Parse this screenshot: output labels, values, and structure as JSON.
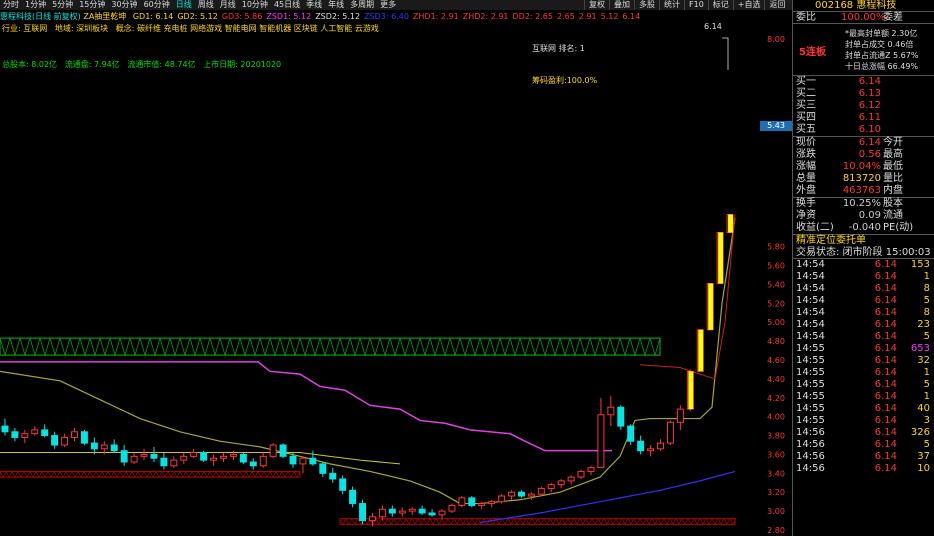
{
  "periods": [
    "分时",
    "1分钟",
    "5分钟",
    "15分钟",
    "30分钟",
    "60分钟",
    "日线",
    "周线",
    "月线",
    "10分钟",
    "45日线",
    "季线",
    "年线",
    "多周期",
    "更多"
  ],
  "active_period": "日线",
  "toolbar": [
    "复权",
    "叠加",
    "多股",
    "统计",
    "F10",
    "标记",
    "+自选",
    "返回"
  ],
  "chart": {
    "title": "惠程科技(日线 前复权)",
    "indicator_name": "ZA抽里乾坤",
    "indicator_values": [
      {
        "label": "GD1: 6.14",
        "color": "#ffd700"
      },
      {
        "label": "GD2: 5.12",
        "color": "#ffd700"
      },
      {
        "label": "GD3: 5.86",
        "color": "#ff3333"
      },
      {
        "label": "ZSD1: 5.12",
        "color": "#ff33ff"
      },
      {
        "label": "ZSD2: 5.12",
        "color": "#ddd"
      },
      {
        "label": "ZSD3: 6.40",
        "color": "#3333ff"
      },
      {
        "label": "ZHD1: 2.91",
        "color": "#ff3333"
      },
      {
        "label": "ZHD2: 2.91",
        "color": "#ff3333"
      },
      {
        "label": "DD2: 2.65",
        "color": "#ff3333"
      },
      {
        "label": "2.65",
        "color": "#ff3333"
      },
      {
        "label": "2.91",
        "color": "#ff3333"
      },
      {
        "label": "5.12",
        "color": "#ff3333"
      },
      {
        "label": "6.14",
        "color": "#ff3333"
      }
    ],
    "industry": "行业: 互联网",
    "region": "地域: 深圳板块",
    "concept": "概念: 碳纤维 充电桩 网络游戏 智能电网 智能机器 区块链 人工智能 云游戏",
    "total_cap": "总股本: 8.02亿",
    "float_cap": "流通盘: 7.94亿",
    "float_value": "流通市值: 48.74亿",
    "listing_date": "上市日期: 20201020",
    "sector_rank": "互联网    排名: 1",
    "chip_profit": "筹码盈利:100.0%",
    "high_label": "6.14",
    "current_price_tag": "5.43",
    "y_axis": {
      "min": 2.8,
      "max": 8.2,
      "ticks": [
        "8.00",
        "5.80",
        "5.60",
        "5.40",
        "5.20",
        "5.00",
        "4.80",
        "4.60",
        "4.40",
        "4.20",
        "4.00",
        "3.80",
        "3.60",
        "3.40",
        "3.20",
        "3.00",
        "2.80"
      ]
    }
  },
  "chart_data": {
    "type": "candlestick",
    "title": "惠程科技(日线 前复权)",
    "candles": [
      [
        3.9,
        3.98,
        3.8,
        3.84
      ],
      [
        3.84,
        3.88,
        3.74,
        3.78
      ],
      [
        3.78,
        3.86,
        3.72,
        3.82
      ],
      [
        3.82,
        3.9,
        3.8,
        3.86
      ],
      [
        3.86,
        3.92,
        3.78,
        3.8
      ],
      [
        3.8,
        3.84,
        3.66,
        3.7
      ],
      [
        3.7,
        3.82,
        3.68,
        3.78
      ],
      [
        3.78,
        3.88,
        3.74,
        3.84
      ],
      [
        3.84,
        3.86,
        3.7,
        3.72
      ],
      [
        3.72,
        3.78,
        3.6,
        3.66
      ],
      [
        3.66,
        3.74,
        3.6,
        3.7
      ],
      [
        3.7,
        3.76,
        3.62,
        3.64
      ],
      [
        3.64,
        3.7,
        3.48,
        3.52
      ],
      [
        3.52,
        3.62,
        3.5,
        3.58
      ],
      [
        3.58,
        3.66,
        3.54,
        3.6
      ],
      [
        3.6,
        3.68,
        3.52,
        3.56
      ],
      [
        3.56,
        3.62,
        3.44,
        3.48
      ],
      [
        3.48,
        3.58,
        3.46,
        3.54
      ],
      [
        3.54,
        3.62,
        3.5,
        3.58
      ],
      [
        3.58,
        3.66,
        3.56,
        3.62
      ],
      [
        3.62,
        3.64,
        3.52,
        3.54
      ],
      [
        3.54,
        3.6,
        3.48,
        3.56
      ],
      [
        3.56,
        3.62,
        3.52,
        3.58
      ],
      [
        3.58,
        3.64,
        3.54,
        3.6
      ],
      [
        3.6,
        3.62,
        3.5,
        3.52
      ],
      [
        3.52,
        3.56,
        3.44,
        3.48
      ],
      [
        3.48,
        3.62,
        3.46,
        3.58
      ],
      [
        3.58,
        3.72,
        3.56,
        3.7
      ],
      [
        3.7,
        3.72,
        3.56,
        3.58
      ],
      [
        3.58,
        3.62,
        3.46,
        3.5
      ],
      [
        3.5,
        3.58,
        3.4,
        3.56
      ],
      [
        3.56,
        3.64,
        3.48,
        3.5
      ],
      [
        3.5,
        3.52,
        3.36,
        3.4
      ],
      [
        3.4,
        3.46,
        3.3,
        3.34
      ],
      [
        3.34,
        3.38,
        3.18,
        3.22
      ],
      [
        3.22,
        3.26,
        3.04,
        3.08
      ],
      [
        3.08,
        3.12,
        2.86,
        2.9
      ],
      [
        2.9,
        2.98,
        2.84,
        2.94
      ],
      [
        2.94,
        3.06,
        2.9,
        3.02
      ],
      [
        3.02,
        3.06,
        2.94,
        2.98
      ],
      [
        2.98,
        3.04,
        2.94,
        3.0
      ],
      [
        3.0,
        3.04,
        2.96,
        3.02
      ],
      [
        3.02,
        3.06,
        2.96,
        2.98
      ],
      [
        2.98,
        3.02,
        2.94,
        2.96
      ],
      [
        2.96,
        3.02,
        2.92,
        3.0
      ],
      [
        3.0,
        3.08,
        2.98,
        3.06
      ],
      [
        3.06,
        3.16,
        3.04,
        3.14
      ],
      [
        3.14,
        3.16,
        3.04,
        3.06
      ],
      [
        3.06,
        3.1,
        3.02,
        3.08
      ],
      [
        3.08,
        3.12,
        3.04,
        3.1
      ],
      [
        3.1,
        3.18,
        3.08,
        3.16
      ],
      [
        3.16,
        3.22,
        3.12,
        3.2
      ],
      [
        3.2,
        3.22,
        3.14,
        3.16
      ],
      [
        3.16,
        3.2,
        3.12,
        3.18
      ],
      [
        3.18,
        3.26,
        3.16,
        3.24
      ],
      [
        3.24,
        3.3,
        3.2,
        3.28
      ],
      [
        3.28,
        3.34,
        3.24,
        3.32
      ],
      [
        3.32,
        3.38,
        3.28,
        3.36
      ],
      [
        3.36,
        3.44,
        3.34,
        3.42
      ],
      [
        3.42,
        3.48,
        3.38,
        3.46
      ],
      [
        3.46,
        4.2,
        3.46,
        4.02
      ],
      [
        4.02,
        4.22,
        3.9,
        4.1
      ],
      [
        4.1,
        4.12,
        3.86,
        3.9
      ],
      [
        3.9,
        3.92,
        3.7,
        3.74
      ],
      [
        3.74,
        3.8,
        3.6,
        3.64
      ],
      [
        3.64,
        3.7,
        3.58,
        3.66
      ],
      [
        3.66,
        3.76,
        3.64,
        3.72
      ],
      [
        3.72,
        3.96,
        3.7,
        3.94
      ],
      [
        3.94,
        4.12,
        3.86,
        4.08
      ],
      [
        4.08,
        4.5,
        4.06,
        4.48
      ],
      [
        4.48,
        4.92,
        4.48,
        4.92
      ],
      [
        4.92,
        5.41,
        4.92,
        5.41
      ],
      [
        5.41,
        5.95,
        5.41,
        5.95
      ],
      [
        5.95,
        6.14,
        5.95,
        6.14
      ]
    ],
    "ylim": [
      2.8,
      8.2
    ]
  },
  "sidebar": {
    "code": "002168",
    "name": "惠程科技",
    "weibi_label": "委比",
    "weibi_value": "100.00%",
    "weicha_label": "委差",
    "streak": "5连板",
    "seal_lines": [
      "*最高封单额 2.30亿",
      "封单占成交 0.46倍",
      "封单占流通Z 5.67%",
      "十日总涨幅 66.49%"
    ],
    "bids": [
      {
        "label": "买一",
        "price": "6.14"
      },
      {
        "label": "买二",
        "price": "6.13"
      },
      {
        "label": "买三",
        "price": "6.12"
      },
      {
        "label": "买四",
        "price": "6.11"
      },
      {
        "label": "买五",
        "price": "6.10"
      }
    ],
    "stats": [
      {
        "l1": "现价",
        "v1": "6.14",
        "l2": "今开"
      },
      {
        "l1": "涨跌",
        "v1": "0.56",
        "l2": "最高"
      },
      {
        "l1": "涨幅",
        "v1": "10.04%",
        "l2": "最低"
      },
      {
        "l1": "总量",
        "v1": "813720",
        "l2": "量比"
      },
      {
        "l1": "外盘",
        "v1": "463763",
        "l2": "内盘"
      }
    ],
    "stats2": [
      {
        "l1": "换手",
        "v1": "10.25%",
        "l2": "股本"
      },
      {
        "l1": "净资",
        "v1": "0.09",
        "l2": "流通"
      },
      {
        "l1": "收益(二)",
        "v1": "-0.040",
        "l2": "PE(动)"
      }
    ],
    "order_title": "精准定位委托单",
    "trade_status": "交易状态: 闭市阶段 15:00:03",
    "ticks": [
      {
        "t": "14:54",
        "p": "6.14",
        "v": "153"
      },
      {
        "t": "14:54",
        "p": "6.14",
        "v": "1"
      },
      {
        "t": "14:54",
        "p": "6.14",
        "v": "8"
      },
      {
        "t": "14:54",
        "p": "6.14",
        "v": "5"
      },
      {
        "t": "14:54",
        "p": "6.14",
        "v": "8"
      },
      {
        "t": "14:54",
        "p": "6.14",
        "v": "23"
      },
      {
        "t": "14:54",
        "p": "6.14",
        "v": "5"
      },
      {
        "t": "14:55",
        "p": "6.14",
        "v": "653"
      },
      {
        "t": "14:55",
        "p": "6.14",
        "v": "32"
      },
      {
        "t": "14:55",
        "p": "6.14",
        "v": "1"
      },
      {
        "t": "14:55",
        "p": "6.14",
        "v": "5"
      },
      {
        "t": "14:55",
        "p": "6.14",
        "v": "1"
      },
      {
        "t": "14:55",
        "p": "6.14",
        "v": "40"
      },
      {
        "t": "14:55",
        "p": "6.14",
        "v": "3"
      },
      {
        "t": "14:56",
        "p": "6.14",
        "v": "326"
      },
      {
        "t": "14:56",
        "p": "6.14",
        "v": "5"
      },
      {
        "t": "14:56",
        "p": "6.14",
        "v": "37"
      },
      {
        "t": "14:56",
        "p": "6.14",
        "v": "10"
      }
    ]
  }
}
